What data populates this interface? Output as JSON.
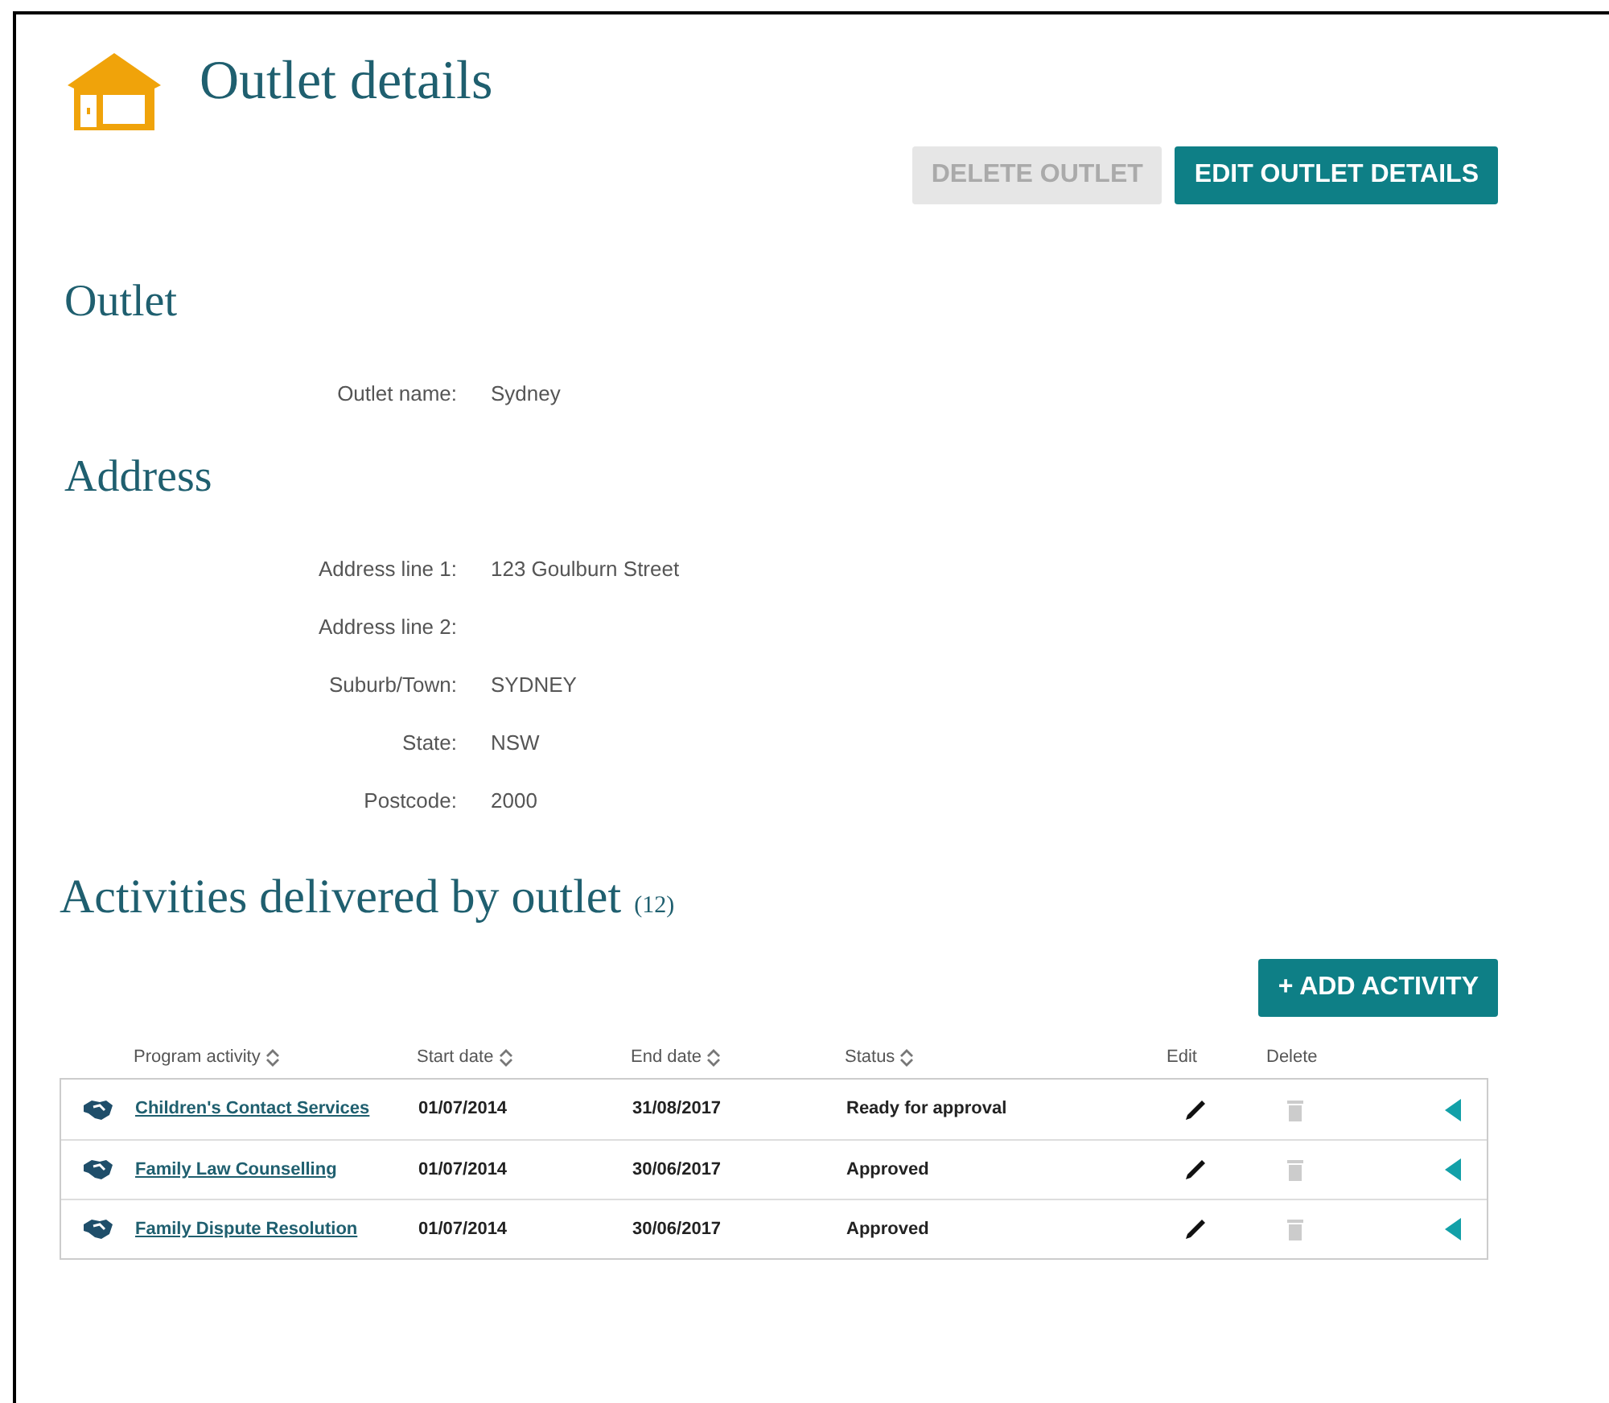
{
  "page": {
    "title": "Outlet details"
  },
  "actions": [
    {
      "label": "DELETE OUTLET",
      "disabled": true
    },
    {
      "label": "EDIT OUTLET DETAILS",
      "disabled": false
    }
  ],
  "outlet_section": {
    "heading": "Outlet",
    "fields": [
      {
        "label": "Outlet name:",
        "value": "Sydney"
      }
    ]
  },
  "address_section": {
    "heading": "Address",
    "fields": [
      {
        "label": "Address line 1:",
        "value": "123 Goulburn Street"
      },
      {
        "label": "Address line 2:"
      },
      {
        "label": "Suburb/Town:",
        "value": "SYDNEY"
      },
      {
        "label": "State:",
        "value": "NSW"
      },
      {
        "label": "Postcode:",
        "value": "2000"
      }
    ]
  },
  "activities": {
    "heading": "Activities delivered by outlet",
    "count": "(12)",
    "add_button": "+ ADD ACTIVITY",
    "columns": [
      {
        "label": "Program activity",
        "sortable": true
      },
      {
        "label": "Start date",
        "sortable": true
      },
      {
        "label": "End date",
        "sortable": true
      },
      {
        "label": "Status",
        "sortable": true
      },
      {
        "label": "Edit",
        "sortable": false
      },
      {
        "label": "Delete",
        "sortable": false
      }
    ],
    "rows": [
      {
        "activity": "Children's Contact Services",
        "start": "01/07/2014",
        "end": "31/08/2017",
        "status": "Ready for approval",
        "delete_disabled": true
      },
      {
        "activity": "Family Law Counselling",
        "start": "01/07/2014",
        "end": "30/06/2017",
        "status": "Approved",
        "delete_disabled": true
      },
      {
        "activity": "Family Dispute Resolution",
        "start": "01/07/2014",
        "end": "30/06/2017",
        "status": "Approved",
        "delete_disabled": true
      }
    ]
  }
}
